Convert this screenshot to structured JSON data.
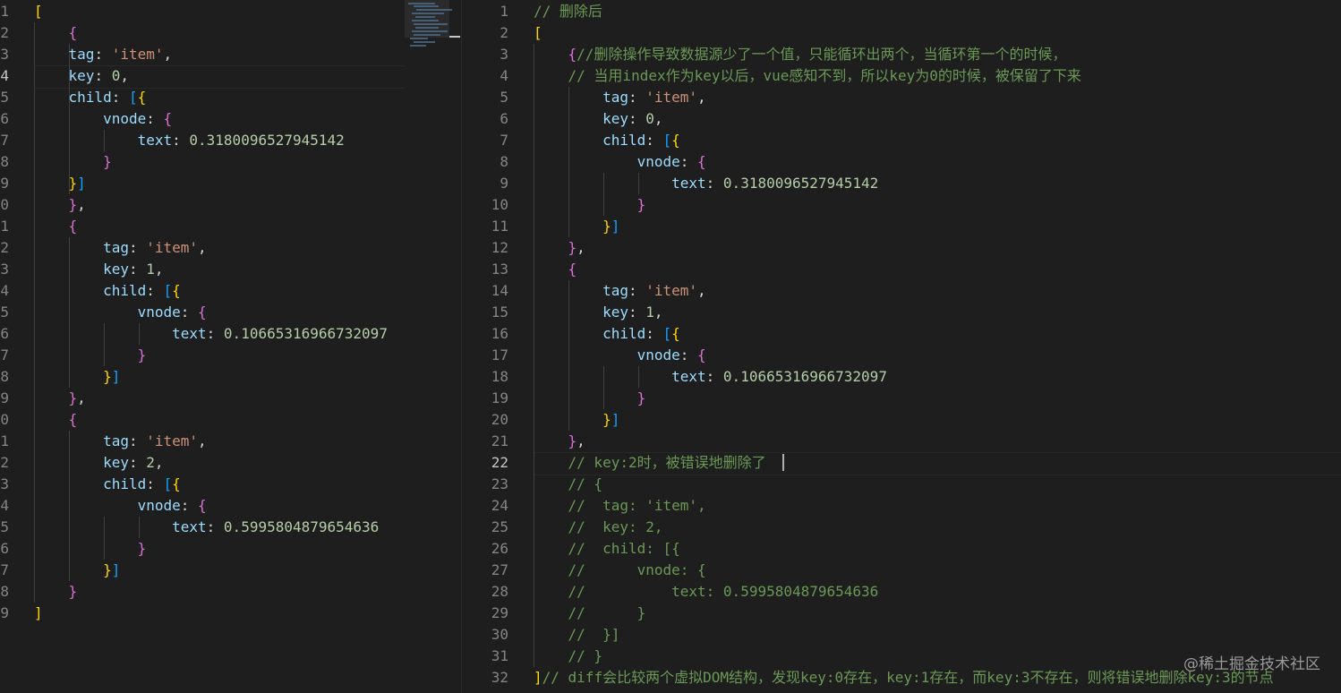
{
  "left_editor": {
    "active_line": 3,
    "lines": [
      {
        "no": "1",
        "tokens": [
          [
            "[",
            "b1"
          ]
        ]
      },
      {
        "no": "2",
        "tokens": [
          [
            "    ",
            "p"
          ],
          [
            "{",
            "b2"
          ]
        ]
      },
      {
        "no": "3",
        "tokens": [
          [
            "    ",
            "p"
          ],
          [
            "tag",
            "k"
          ],
          [
            ": ",
            "p"
          ],
          [
            "'item'",
            "s"
          ],
          [
            ",",
            "p"
          ]
        ]
      },
      {
        "no": "4",
        "tokens": [
          [
            "    ",
            "p"
          ],
          [
            "key",
            "k"
          ],
          [
            ": ",
            "p"
          ],
          [
            "0",
            "n"
          ],
          [
            ",",
            "p"
          ]
        ]
      },
      {
        "no": "5",
        "tokens": [
          [
            "    ",
            "p"
          ],
          [
            "child",
            "k"
          ],
          [
            ": ",
            "p"
          ],
          [
            "[",
            "b3"
          ],
          [
            "{",
            "b1"
          ]
        ]
      },
      {
        "no": "6",
        "tokens": [
          [
            "        ",
            "p"
          ],
          [
            "vnode",
            "k"
          ],
          [
            ": ",
            "p"
          ],
          [
            "{",
            "b2"
          ]
        ]
      },
      {
        "no": "7",
        "tokens": [
          [
            "            ",
            "p"
          ],
          [
            "text",
            "k"
          ],
          [
            ": ",
            "p"
          ],
          [
            "0.3180096527945142",
            "n"
          ]
        ]
      },
      {
        "no": "8",
        "tokens": [
          [
            "        ",
            "p"
          ],
          [
            "}",
            "b2"
          ]
        ]
      },
      {
        "no": "9",
        "tokens": [
          [
            "    ",
            "p"
          ],
          [
            "}",
            "b1"
          ],
          [
            "]",
            "b3"
          ]
        ]
      },
      {
        "no": "0",
        "tokens": [
          [
            "    ",
            "p"
          ],
          [
            "}",
            "b2"
          ],
          [
            ",",
            "p"
          ]
        ]
      },
      {
        "no": "1",
        "tokens": [
          [
            "    ",
            "p"
          ],
          [
            "{",
            "b2"
          ]
        ]
      },
      {
        "no": "2",
        "tokens": [
          [
            "        ",
            "p"
          ],
          [
            "tag",
            "k"
          ],
          [
            ": ",
            "p"
          ],
          [
            "'item'",
            "s"
          ],
          [
            ",",
            "p"
          ]
        ]
      },
      {
        "no": "3",
        "tokens": [
          [
            "        ",
            "p"
          ],
          [
            "key",
            "k"
          ],
          [
            ": ",
            "p"
          ],
          [
            "1",
            "n"
          ],
          [
            ",",
            "p"
          ]
        ]
      },
      {
        "no": "4",
        "tokens": [
          [
            "        ",
            "p"
          ],
          [
            "child",
            "k"
          ],
          [
            ": ",
            "p"
          ],
          [
            "[",
            "b3"
          ],
          [
            "{",
            "b1"
          ]
        ]
      },
      {
        "no": "5",
        "tokens": [
          [
            "            ",
            "p"
          ],
          [
            "vnode",
            "k"
          ],
          [
            ": ",
            "p"
          ],
          [
            "{",
            "b2"
          ]
        ]
      },
      {
        "no": "6",
        "tokens": [
          [
            "                ",
            "p"
          ],
          [
            "text",
            "k"
          ],
          [
            ": ",
            "p"
          ],
          [
            "0.10665316966732097",
            "n"
          ]
        ]
      },
      {
        "no": "7",
        "tokens": [
          [
            "            ",
            "p"
          ],
          [
            "}",
            "b2"
          ]
        ]
      },
      {
        "no": "8",
        "tokens": [
          [
            "        ",
            "p"
          ],
          [
            "}",
            "b1"
          ],
          [
            "]",
            "b3"
          ]
        ]
      },
      {
        "no": "9",
        "tokens": [
          [
            "    ",
            "p"
          ],
          [
            "}",
            "b2"
          ],
          [
            ",",
            "p"
          ]
        ]
      },
      {
        "no": "0",
        "tokens": [
          [
            "    ",
            "p"
          ],
          [
            "{",
            "b2"
          ]
        ]
      },
      {
        "no": "1",
        "tokens": [
          [
            "        ",
            "p"
          ],
          [
            "tag",
            "k"
          ],
          [
            ": ",
            "p"
          ],
          [
            "'item'",
            "s"
          ],
          [
            ",",
            "p"
          ]
        ]
      },
      {
        "no": "2",
        "tokens": [
          [
            "        ",
            "p"
          ],
          [
            "key",
            "k"
          ],
          [
            ": ",
            "p"
          ],
          [
            "2",
            "n"
          ],
          [
            ",",
            "p"
          ]
        ]
      },
      {
        "no": "3",
        "tokens": [
          [
            "        ",
            "p"
          ],
          [
            "child",
            "k"
          ],
          [
            ": ",
            "p"
          ],
          [
            "[",
            "b3"
          ],
          [
            "{",
            "b1"
          ]
        ]
      },
      {
        "no": "4",
        "tokens": [
          [
            "            ",
            "p"
          ],
          [
            "vnode",
            "k"
          ],
          [
            ": ",
            "p"
          ],
          [
            "{",
            "b2"
          ]
        ]
      },
      {
        "no": "5",
        "tokens": [
          [
            "                ",
            "p"
          ],
          [
            "text",
            "k"
          ],
          [
            ": ",
            "p"
          ],
          [
            "0.5995804879654636",
            "n"
          ]
        ]
      },
      {
        "no": "6",
        "tokens": [
          [
            "            ",
            "p"
          ],
          [
            "}",
            "b2"
          ]
        ]
      },
      {
        "no": "7",
        "tokens": [
          [
            "        ",
            "p"
          ],
          [
            "}",
            "b1"
          ],
          [
            "]",
            "b3"
          ]
        ]
      },
      {
        "no": "8",
        "tokens": [
          [
            "    ",
            "p"
          ],
          [
            "}",
            "b2"
          ]
        ]
      },
      {
        "no": "9",
        "tokens": [
          [
            "]",
            "b1"
          ]
        ]
      }
    ]
  },
  "right_editor": {
    "active_line": 21,
    "lines": [
      {
        "no": "1",
        "tokens": [
          [
            "// 删除后",
            "c"
          ]
        ]
      },
      {
        "no": "2",
        "tokens": [
          [
            "[",
            "b1"
          ]
        ]
      },
      {
        "no": "3",
        "tokens": [
          [
            "    ",
            "p"
          ],
          [
            "{",
            "b2"
          ],
          [
            "//删除操作导致数据源少了一个值，只能循环出两个，当循环第一个的时候，",
            "c"
          ]
        ]
      },
      {
        "no": "4",
        "tokens": [
          [
            "    ",
            "p"
          ],
          [
            "// 当用index作为key以后，vue感知不到，所以key为0的时候，被保留了下来",
            "c"
          ]
        ]
      },
      {
        "no": "5",
        "tokens": [
          [
            "        ",
            "p"
          ],
          [
            "tag",
            "k"
          ],
          [
            ": ",
            "p"
          ],
          [
            "'item'",
            "s"
          ],
          [
            ",",
            "p"
          ]
        ]
      },
      {
        "no": "6",
        "tokens": [
          [
            "        ",
            "p"
          ],
          [
            "key",
            "k"
          ],
          [
            ": ",
            "p"
          ],
          [
            "0",
            "n"
          ],
          [
            ",",
            "p"
          ]
        ]
      },
      {
        "no": "7",
        "tokens": [
          [
            "        ",
            "p"
          ],
          [
            "child",
            "k"
          ],
          [
            ": ",
            "p"
          ],
          [
            "[",
            "b3"
          ],
          [
            "{",
            "b1"
          ]
        ]
      },
      {
        "no": "8",
        "tokens": [
          [
            "            ",
            "p"
          ],
          [
            "vnode",
            "k"
          ],
          [
            ": ",
            "p"
          ],
          [
            "{",
            "b2"
          ]
        ]
      },
      {
        "no": "9",
        "tokens": [
          [
            "                ",
            "p"
          ],
          [
            "text",
            "k"
          ],
          [
            ": ",
            "p"
          ],
          [
            "0.3180096527945142",
            "n"
          ]
        ]
      },
      {
        "no": "10",
        "tokens": [
          [
            "            ",
            "p"
          ],
          [
            "}",
            "b2"
          ]
        ]
      },
      {
        "no": "11",
        "tokens": [
          [
            "        ",
            "p"
          ],
          [
            "}",
            "b1"
          ],
          [
            "]",
            "b3"
          ]
        ]
      },
      {
        "no": "12",
        "tokens": [
          [
            "    ",
            "p"
          ],
          [
            "}",
            "b2"
          ],
          [
            ",",
            "p"
          ]
        ]
      },
      {
        "no": "13",
        "tokens": [
          [
            "    ",
            "p"
          ],
          [
            "{",
            "b2"
          ]
        ]
      },
      {
        "no": "14",
        "tokens": [
          [
            "        ",
            "p"
          ],
          [
            "tag",
            "k"
          ],
          [
            ": ",
            "p"
          ],
          [
            "'item'",
            "s"
          ],
          [
            ",",
            "p"
          ]
        ]
      },
      {
        "no": "15",
        "tokens": [
          [
            "        ",
            "p"
          ],
          [
            "key",
            "k"
          ],
          [
            ": ",
            "p"
          ],
          [
            "1",
            "n"
          ],
          [
            ",",
            "p"
          ]
        ]
      },
      {
        "no": "16",
        "tokens": [
          [
            "        ",
            "p"
          ],
          [
            "child",
            "k"
          ],
          [
            ": ",
            "p"
          ],
          [
            "[",
            "b3"
          ],
          [
            "{",
            "b1"
          ]
        ]
      },
      {
        "no": "17",
        "tokens": [
          [
            "            ",
            "p"
          ],
          [
            "vnode",
            "k"
          ],
          [
            ": ",
            "p"
          ],
          [
            "{",
            "b2"
          ]
        ]
      },
      {
        "no": "18",
        "tokens": [
          [
            "                ",
            "p"
          ],
          [
            "text",
            "k"
          ],
          [
            ": ",
            "p"
          ],
          [
            "0.10665316966732097",
            "n"
          ]
        ]
      },
      {
        "no": "19",
        "tokens": [
          [
            "            ",
            "p"
          ],
          [
            "}",
            "b2"
          ]
        ]
      },
      {
        "no": "20",
        "tokens": [
          [
            "        ",
            "p"
          ],
          [
            "}",
            "b1"
          ],
          [
            "]",
            "b3"
          ]
        ]
      },
      {
        "no": "21",
        "tokens": [
          [
            "    ",
            "p"
          ],
          [
            "}",
            "b2"
          ],
          [
            ",",
            "p"
          ]
        ]
      },
      {
        "no": "22",
        "tokens": [
          [
            "    ",
            "p"
          ],
          [
            "// key:2时，被错误地删除了",
            "c"
          ]
        ]
      },
      {
        "no": "23",
        "tokens": [
          [
            "    ",
            "p"
          ],
          [
            "// {",
            "c"
          ]
        ]
      },
      {
        "no": "24",
        "tokens": [
          [
            "    ",
            "p"
          ],
          [
            "//  tag: 'item',",
            "c"
          ]
        ]
      },
      {
        "no": "25",
        "tokens": [
          [
            "    ",
            "p"
          ],
          [
            "//  key: 2,",
            "c"
          ]
        ]
      },
      {
        "no": "26",
        "tokens": [
          [
            "    ",
            "p"
          ],
          [
            "//  child: [{",
            "c"
          ]
        ]
      },
      {
        "no": "27",
        "tokens": [
          [
            "    ",
            "p"
          ],
          [
            "//      vnode: {",
            "c"
          ]
        ]
      },
      {
        "no": "28",
        "tokens": [
          [
            "    ",
            "p"
          ],
          [
            "//          text: 0.5995804879654636",
            "c"
          ]
        ]
      },
      {
        "no": "29",
        "tokens": [
          [
            "    ",
            "p"
          ],
          [
            "//      }",
            "c"
          ]
        ]
      },
      {
        "no": "30",
        "tokens": [
          [
            "    ",
            "p"
          ],
          [
            "//  }]",
            "c"
          ]
        ]
      },
      {
        "no": "31",
        "tokens": [
          [
            "    ",
            "p"
          ],
          [
            "// }",
            "c"
          ]
        ]
      },
      {
        "no": "32",
        "tokens": [
          [
            "]",
            "b1"
          ],
          [
            "// diff会比较两个虚拟DOM结构，发现key:0存在，key:1存在，而key:3不存在，则将错误地删除key:3的节点",
            "c"
          ]
        ]
      }
    ]
  },
  "watermark": "@稀土掘金技术社区",
  "colors": {
    "background": "#1e1e1e",
    "line_number": "#858585",
    "property": "#9cdcfe",
    "string": "#ce9178",
    "number": "#b5cea8",
    "comment": "#6a9955",
    "bracket_1": "#ffd700",
    "bracket_2": "#da70d6",
    "bracket_3": "#179fff"
  }
}
